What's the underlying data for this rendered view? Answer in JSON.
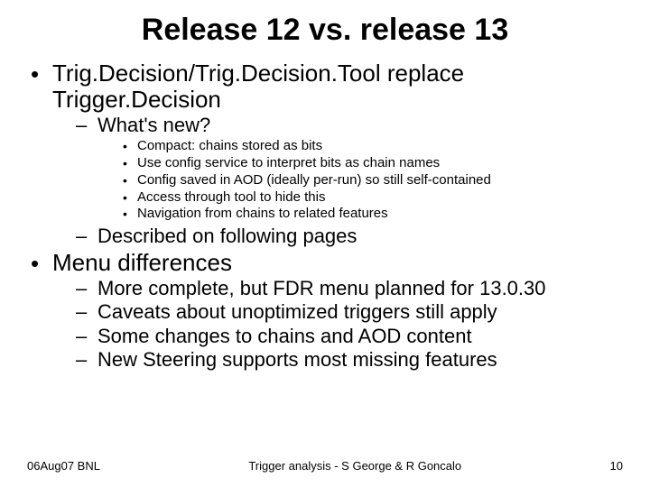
{
  "title": "Release 12 vs. release 13",
  "bullets": {
    "b0": {
      "text": "Trig.Decision/Trig.Decision.Tool replace Trigger.Decision",
      "sub": {
        "s0": {
          "text": "What's new?",
          "sub": {
            "t0": "Compact: chains stored as bits",
            "t1": "Use config service to interpret bits as chain names",
            "t2": "Config saved in AOD (ideally per-run) so still self-contained",
            "t3": "Access through tool to hide this",
            "t4": "Navigation from chains to related features"
          }
        },
        "s1": {
          "text": "Described on following pages"
        }
      }
    },
    "b1": {
      "text": "Menu differences",
      "sub": {
        "s0": {
          "text": "More complete, but FDR menu planned for 13.0.30"
        },
        "s1": {
          "text": "Caveats about unoptimized triggers still apply"
        },
        "s2": {
          "text": "Some changes to chains and AOD content"
        },
        "s3": {
          "text": "New Steering supports most missing features"
        }
      }
    }
  },
  "footer": {
    "left": "06Aug07 BNL",
    "center": "Trigger analysis - S George & R Goncalo",
    "right": "10"
  }
}
